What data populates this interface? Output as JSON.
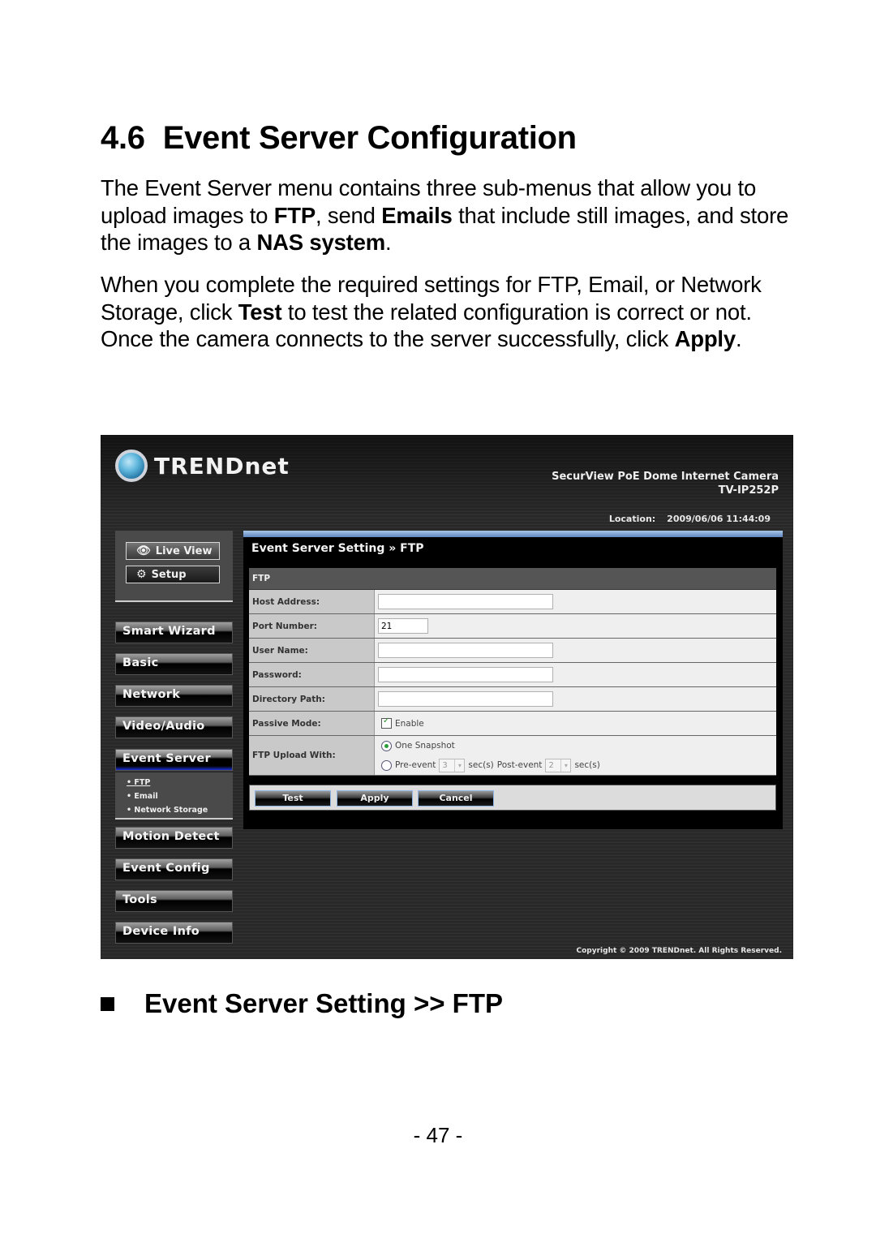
{
  "doc": {
    "section_number": "4.6",
    "section_title": "Event Server Configuration",
    "para1": [
      {
        "t": "The Event Server menu contains three sub-menus that allow you to upload images to ",
        "b": false
      },
      {
        "t": "FTP",
        "b": true
      },
      {
        "t": ", send ",
        "b": false
      },
      {
        "t": "Emails",
        "b": true
      },
      {
        "t": " that include still images, and store the images to a ",
        "b": false
      },
      {
        "t": "NAS system",
        "b": true
      },
      {
        "t": ".",
        "b": false
      }
    ],
    "para2": [
      {
        "t": "When you complete the required settings for FTP, Email, or Network Storage, click ",
        "b": false
      },
      {
        "t": "Test",
        "b": true
      },
      {
        "t": " to test the related configuration is correct or not. Once the camera connects to the server successfully, click ",
        "b": false
      },
      {
        "t": "Apply",
        "b": true
      },
      {
        "t": ".",
        "b": false
      }
    ],
    "bullet_heading": "Event Server Setting >> FTP",
    "page_number": "- 47 -"
  },
  "screenshot": {
    "brand": "TRENDnet",
    "product_name": "SecurView PoE Dome Internet Camera",
    "model": "TV-IP252P",
    "location_label": "Location:",
    "location_time": "2009/06/06 11:44:09",
    "top_buttons": {
      "live_view": "Live View",
      "setup": "Setup"
    },
    "nav": [
      {
        "label": "Smart Wizard"
      },
      {
        "label": "Basic"
      },
      {
        "label": "Network"
      },
      {
        "label": "Video/Audio"
      },
      {
        "label": "Event Server",
        "active": true
      },
      {
        "label": "Motion Detect"
      },
      {
        "label": "Event Config"
      },
      {
        "label": "Tools"
      },
      {
        "label": "Device Info"
      }
    ],
    "submenu": [
      "FTP",
      "Email",
      "Network Storage"
    ],
    "submenu_current": "FTP",
    "panel_title": "Event Server Setting » FTP",
    "section_header": "FTP",
    "fields": {
      "host_address": {
        "label": "Host Address:",
        "value": ""
      },
      "port_number": {
        "label": "Port Number:",
        "value": "21"
      },
      "user_name": {
        "label": "User Name:",
        "value": ""
      },
      "password": {
        "label": "Password:",
        "value": ""
      },
      "directory_path": {
        "label": "Directory Path:",
        "value": ""
      },
      "passive_mode": {
        "label": "Passive Mode:",
        "option": "Enable",
        "checked": true
      },
      "upload_with": {
        "label": "FTP Upload With:",
        "option_one": "One Snapshot",
        "option_two": "Pre-event",
        "pre_event_value": "3",
        "sec_label": "sec(s)",
        "post_event_label": "Post-event",
        "post_event_value": "2",
        "selected": "One Snapshot"
      }
    },
    "buttons": {
      "test": "Test",
      "apply": "Apply",
      "cancel": "Cancel"
    },
    "copyright": "Copyright © 2009 TRENDnet. All Rights Reserved."
  }
}
